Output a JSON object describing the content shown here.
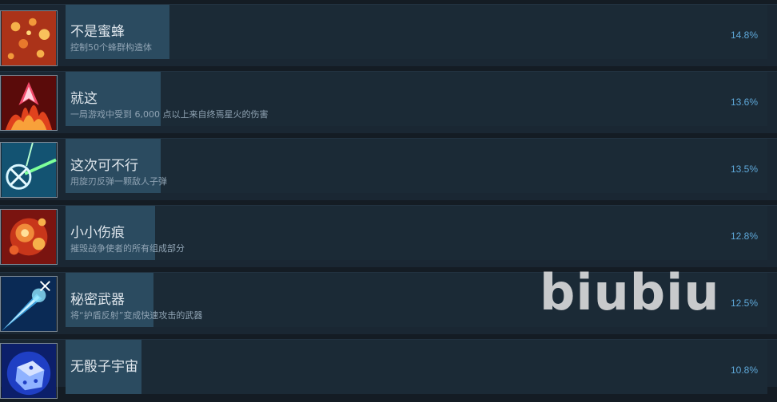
{
  "achievements": [
    {
      "title": "不是蜜蜂",
      "description": "控制50个蜂群构造体",
      "percent": "14.8%",
      "percent_value": 14.8,
      "icon": "bee-swarm-icon"
    },
    {
      "title": "就这",
      "description": "一局游戏中受到 6,000 点以上来自终焉星火的伤害",
      "percent": "13.6%",
      "percent_value": 13.6,
      "icon": "flame-arrow-icon"
    },
    {
      "title": "这次可不行",
      "description": "用旋刃反弹一颗敌人子弹",
      "percent": "13.5%",
      "percent_value": 13.5,
      "icon": "spinning-blade-icon"
    },
    {
      "title": "小小伤痕",
      "description": "摧毁战争使者的所有组成部分",
      "percent": "12.8%",
      "percent_value": 12.8,
      "icon": "explosion-icon"
    },
    {
      "title": "秘密武器",
      "description": "将“护盾反射”变成快速攻击的武器",
      "percent": "12.5%",
      "percent_value": 12.5,
      "icon": "comet-blade-icon"
    },
    {
      "title": "无骰子宇宙",
      "description": "",
      "percent": "10.8%",
      "percent_value": 10.8,
      "icon": "dice-icon"
    }
  ],
  "watermark": "biubiu"
}
